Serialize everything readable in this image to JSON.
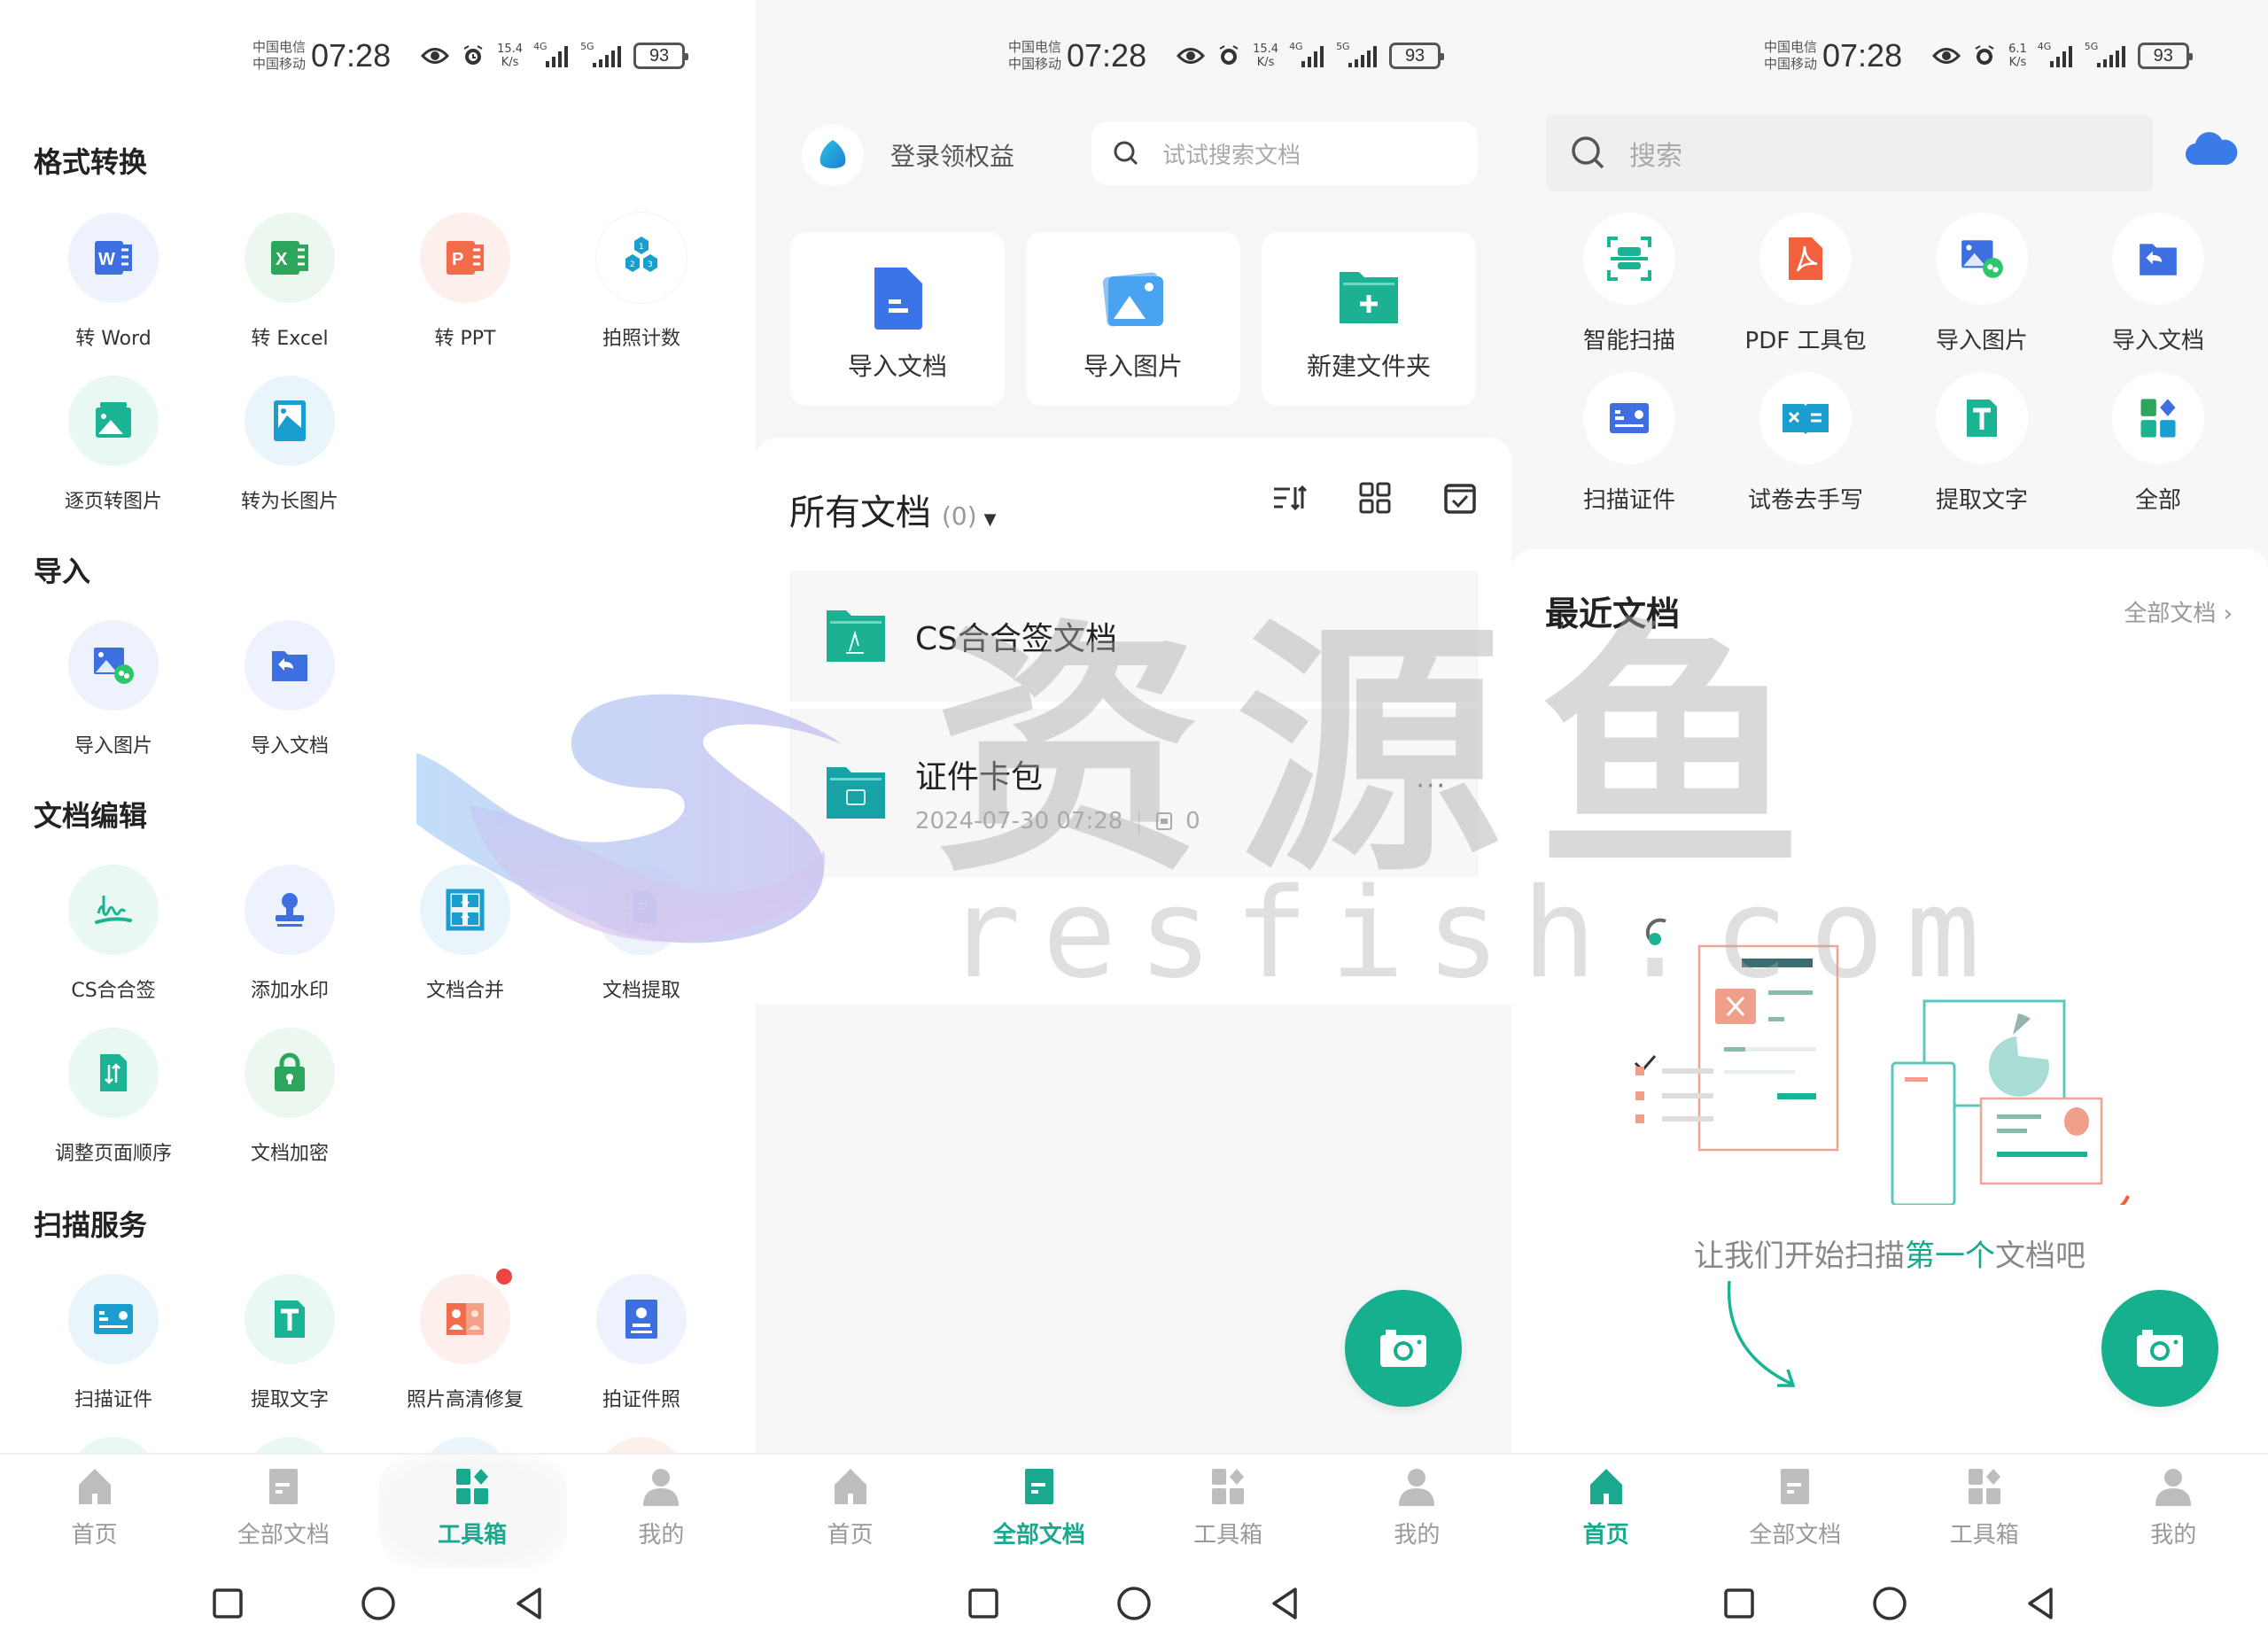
{
  "status_bar": {
    "carrier_1": "中国电信",
    "carrier_2": "中国移动",
    "time": "07:28",
    "battery": "93",
    "net_speed_panels": [
      {
        "value": "15.4",
        "unit": "K/s"
      },
      {
        "value": "15.4",
        "unit": "K/s"
      },
      {
        "value": "6.1",
        "unit": "K/s"
      }
    ],
    "signal_1": "4G",
    "signal_2": "5G",
    "icons": [
      "eye-comfort-icon",
      "alarm-icon"
    ]
  },
  "toolbox_screen": {
    "sections": [
      {
        "title": "格式转换",
        "items": [
          {
            "label": "转 Word",
            "icon": "word-icon",
            "color": "#3d6fe0",
            "bg": "#eef2fd"
          },
          {
            "label": "转 Excel",
            "icon": "excel-icon",
            "color": "#2ea55c",
            "bg": "#ecf7f0"
          },
          {
            "label": "转 PPT",
            "icon": "ppt-icon",
            "color": "#f26b4a",
            "bg": "#fdf0ec"
          },
          {
            "label": "拍照计数",
            "icon": "photo-count-icon",
            "color": "#1a9ecf",
            "bg": "#ffffff"
          },
          {
            "label": "逐页转图片",
            "icon": "pages-to-image-icon",
            "color": "#1ab394",
            "bg": "#eaf8f4"
          },
          {
            "label": "转为长图片",
            "icon": "long-image-icon",
            "color": "#1a9ecf",
            "bg": "#eaf5fb"
          }
        ]
      },
      {
        "title": "导入",
        "items": [
          {
            "label": "导入图片",
            "icon": "import-image-icon",
            "color": "#3d6fe0",
            "bg": "#eef2fd"
          },
          {
            "label": "导入文档",
            "icon": "import-document-icon",
            "color": "#3d6fe0",
            "bg": "#eef2fd"
          }
        ]
      },
      {
        "title": "文档编辑",
        "items": [
          {
            "label": "CS合合签",
            "icon": "signature-icon",
            "color": "#1ab394",
            "bg": "#eaf8f4"
          },
          {
            "label": "添加水印",
            "icon": "watermark-stamp-icon",
            "color": "#3d6fe0",
            "bg": "#eef2fd"
          },
          {
            "label": "文档合并",
            "icon": "merge-document-icon",
            "color": "#1a9ecf",
            "bg": "#eaf5fb"
          },
          {
            "label": "文档提取",
            "icon": "extract-document-icon",
            "color": "#3d6fe0",
            "bg": "#eef2fd"
          },
          {
            "label": "调整页面顺序",
            "icon": "reorder-pages-icon",
            "color": "#1ab394",
            "bg": "#eaf8f4"
          },
          {
            "label": "文档加密",
            "icon": "lock-icon",
            "color": "#2ea55c",
            "bg": "#ecf7f0"
          }
        ]
      },
      {
        "title": "扫描服务",
        "items": [
          {
            "label": "扫描证件",
            "icon": "id-card-scan-icon",
            "color": "#1a9ecf",
            "bg": "#eaf5fb"
          },
          {
            "label": "提取文字",
            "icon": "extract-text-icon",
            "color": "#1ab394",
            "bg": "#eaf8f4"
          },
          {
            "label": "照片高清修复",
            "icon": "photo-restore-icon",
            "color": "#f26b4a",
            "bg": "#fdf0ec",
            "badge": true
          },
          {
            "label": "拍证件照",
            "icon": "id-photo-icon",
            "color": "#3d6fe0",
            "bg": "#eef2fd"
          }
        ]
      }
    ]
  },
  "all_docs_screen": {
    "login_label": "登录领权益",
    "search_placeholder": "试试搜索文档",
    "quick_actions": [
      {
        "label": "导入文档",
        "icon": "import-document-icon"
      },
      {
        "label": "导入图片",
        "icon": "import-image-icon"
      },
      {
        "label": "新建文件夹",
        "icon": "new-folder-icon"
      }
    ],
    "list_title": "所有文档",
    "list_count": "(0)",
    "folders": [
      {
        "name": "CS合合签文档",
        "icon": "signature-folder-icon"
      },
      {
        "name": "证件卡包",
        "icon": "id-folder-icon",
        "date": "2024-07-30 07:28",
        "doc_count": "0",
        "more": "···"
      }
    ]
  },
  "home_screen": {
    "search_placeholder": "搜索",
    "tools": [
      {
        "label": "智能扫描",
        "icon": "smart-scan-icon"
      },
      {
        "label": "PDF 工具包",
        "icon": "pdf-toolkit-icon"
      },
      {
        "label": "导入图片",
        "icon": "import-image-icon"
      },
      {
        "label": "导入文档",
        "icon": "import-document-icon"
      },
      {
        "label": "扫描证件",
        "icon": "id-card-scan-icon"
      },
      {
        "label": "试卷去手写",
        "icon": "remove-handwriting-icon"
      },
      {
        "label": "提取文字",
        "icon": "extract-text-icon"
      },
      {
        "label": "全部",
        "icon": "all-tools-icon"
      }
    ],
    "recent_title": "最近文档",
    "recent_more": "全部文档",
    "empty_prefix": "让我们开始扫描",
    "empty_highlight": "第一个",
    "empty_suffix": "文档吧"
  },
  "bottom_nav": {
    "items": [
      {
        "label": "首页",
        "icon": "home-icon"
      },
      {
        "label": "全部文档",
        "icon": "documents-icon"
      },
      {
        "label": "工具箱",
        "icon": "toolbox-icon"
      },
      {
        "label": "我的",
        "icon": "profile-icon"
      }
    ],
    "active_by_panel": [
      "工具箱",
      "全部文档",
      "首页"
    ]
  },
  "watermark": {
    "cn": "资源鱼",
    "en": "resfish.com"
  },
  "colors": {
    "accent": "#16b08f",
    "inactive_nav": "#bdbdbd",
    "nav_label_inactive": "#999999"
  }
}
